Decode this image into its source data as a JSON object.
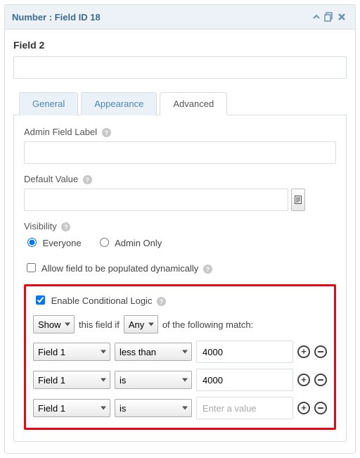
{
  "header": {
    "title": "Number : Field ID 18"
  },
  "field_title": "Field 2",
  "top_input_value": "",
  "tabs": {
    "general": "General",
    "appearance": "Appearance",
    "advanced": "Advanced"
  },
  "adv": {
    "admin_label_lbl": "Admin Field Label",
    "admin_label_value": "",
    "default_value_lbl": "Default Value",
    "default_value_value": "",
    "visibility_lbl": "Visibility",
    "visibility_everyone": "Everyone",
    "visibility_admin": "Admin Only",
    "allow_dynamic_lbl": "Allow field to be populated dynamically",
    "enable_cond_lbl": "Enable Conditional Logic",
    "sentence": {
      "action": "Show",
      "mid1": "this field if",
      "match": "Any",
      "mid2": "of the following match:"
    },
    "rules": [
      {
        "field": "Field 1",
        "operator": "less than",
        "value": "4000",
        "placeholder": ""
      },
      {
        "field": "Field 1",
        "operator": "is",
        "value": "4000",
        "placeholder": ""
      },
      {
        "field": "Field 1",
        "operator": "is",
        "value": "",
        "placeholder": "Enter a value"
      }
    ]
  },
  "help_glyph": "?"
}
